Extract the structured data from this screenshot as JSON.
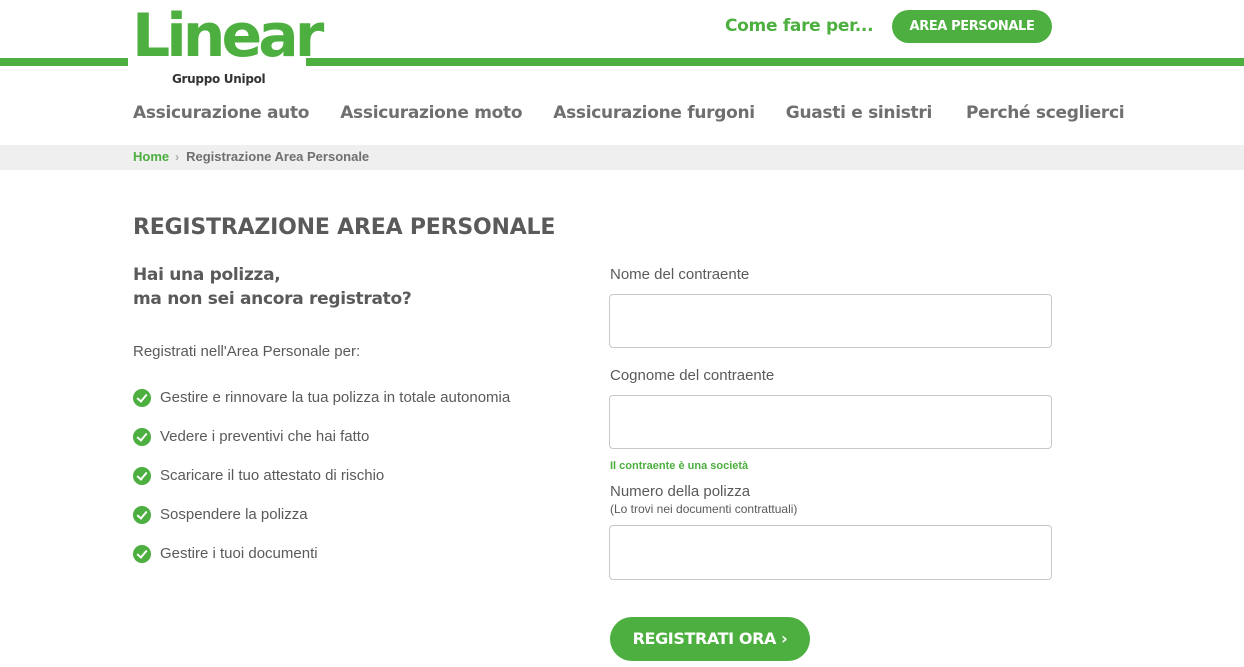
{
  "header": {
    "logo_text": "Linear",
    "logo_subtitle": "Gruppo Unipol",
    "howto_label": "Come fare per...",
    "area_button_label": "AREA PERSONALE"
  },
  "nav": {
    "items": [
      {
        "label": "Assicurazione auto"
      },
      {
        "label": "Assicurazione moto"
      },
      {
        "label": "Assicurazione furgoni"
      },
      {
        "label": "Guasti e sinistri"
      },
      {
        "label": "Perché sceglierci"
      }
    ]
  },
  "breadcrumb": {
    "home": "Home",
    "separator": "›",
    "current": "Registrazione Area Personale"
  },
  "main": {
    "title": "REGISTRAZIONE AREA PERSONALE",
    "lead_line1": "Hai una polizza,",
    "lead_line2": "ma non sei ancora registrato?",
    "intro": "Registrati nell'Area Personale per:",
    "benefits": [
      "Gestire e rinnovare la tua polizza in totale autonomia",
      "Vedere i preventivi che hai fatto",
      "Scaricare il tuo attestato di rischio",
      "Sospendere la polizza",
      "Gestire i tuoi documenti"
    ]
  },
  "form": {
    "first_name_label": "Nome del contraente",
    "first_name_value": "",
    "last_name_label": "Cognome del contraente",
    "last_name_value": "",
    "company_link": "Il contraente è una società",
    "policy_label": "Numero della polizza",
    "policy_hint": "(Lo trovi nei documenti contrattuali)",
    "policy_value": "",
    "submit_label": "REGISTRATI ORA ›"
  },
  "colors": {
    "brand_green": "#4caf3f",
    "text_gray": "#5a5a5a",
    "breadcrumb_bg": "#efefef"
  }
}
